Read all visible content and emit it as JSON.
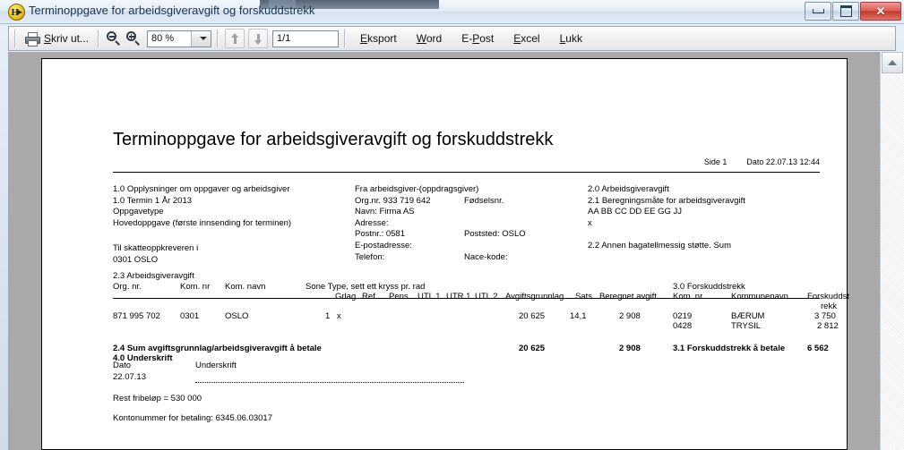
{
  "window": {
    "title": "Terminoppgave for arbeidsgiveravgift og forskuddstrekk",
    "app_icon_letter": "H",
    "minimize_label": "Minimer",
    "maximize_label": "Maksimer",
    "close_label": "Lukk vindu"
  },
  "toolbar": {
    "print_label_pre": "S",
    "print_label_post": "kriv ut...",
    "zoom_out_icon": "zoom-out-icon",
    "zoom_in_icon": "zoom-in-icon",
    "zoom_value": "80 %",
    "page_prev_icon": "page-up-icon",
    "page_next_icon": "page-down-icon",
    "page_value": "1/1",
    "buttons": [
      {
        "pre": "E",
        "mid": "ksport",
        "post": ""
      },
      {
        "pre": "W",
        "mid": "ord",
        "post": ""
      },
      {
        "pre": "E-",
        "mid": "P",
        "post": "ost"
      },
      {
        "pre": "E",
        "mid": "xcel",
        "post": ""
      },
      {
        "pre": "L",
        "mid": "ukk",
        "post": ""
      }
    ],
    "export_label": "Eksport",
    "word_label": "Word",
    "epost_label": "E-Post",
    "excel_label": "Excel",
    "lukk_label": "Lukk"
  },
  "document": {
    "title": "Terminoppgave for arbeidsgiveravgift og forskuddstrekk",
    "page_label": "Side 1",
    "date_label": "Dato  22.07.13 12:44",
    "section_1_0": "1.0 Opplysninger om oppgaver og arbeidsgiver",
    "termin_line": "1.0 Termin   1   År   2013",
    "oppgavetype": "Oppgavetype",
    "hovedoppgave": "Hovedoppgave (første innsending for terminen)",
    "til_skatteoppkreveren": "Til skatteoppkreveren i",
    "til_kommune": "0301 OSLO",
    "fra_arbeidsgiver": "Fra arbeidsgiver-(oppdragsgiver)",
    "orgnr_label": "Org.nr. 933 719 642",
    "fodselsnr_label": "Fødselsnr.",
    "navn_label": "Navn: Firma AS",
    "adresse_label": "Adresse:",
    "postnr_label": "Postnr.: 0581",
    "poststed_label": "Poststed: OSLO",
    "epostadresse_label": "E-postadresse:",
    "telefon_label": "Telefon:",
    "nacekode_label": "Nace-kode:",
    "section_2_0": "2.0 Arbeidsgiveravgift",
    "section_2_1": "2.1 Beregningsmåte for arbeidsgiveravgift",
    "beregning_codes": "AA   BB   CC   DD     EE   GG   JJ",
    "beregning_mark": "x",
    "section_2_2": "2.2 Annen bagatellmessig støtte. Sum",
    "section_2_3": "2.3 Arbeidsgiveravgift",
    "section_3_0": "3.0 Forskuddstrekk",
    "table_headers": {
      "orgnr": "Org. nr.",
      "komnr": "Kom. nr",
      "komnavn": "Kom. navn",
      "sone_type": "Sone Type, sett ett kryss pr. rad",
      "grlag": "Grlag",
      "ref": "Ref",
      "pens": "Pens",
      "utl1": "UTL 1",
      "utr1": "UTR 1",
      "utl2": "UTL 2",
      "avgiftsgrunnlag": "Avgiftsgrunnlag",
      "sats": "Sats",
      "beregnet_avgift": "Beregnet avgift",
      "f_komnr": "Kom. nr",
      "f_kommunenavn": "Kommunenavn",
      "f_forskuddstrekk_l1": "Forskuddst",
      "f_forskuddstrekk_l2": "rekk"
    },
    "table_row": {
      "orgnr": "871 995 702",
      "komnr": "0301",
      "komnavn": "OSLO",
      "sone": "1",
      "kryss": "x",
      "avgiftsgrunnlag": "20 625",
      "sats": "14,1",
      "beregnet_avgift": "2 908"
    },
    "forskudd_rows": [
      {
        "komnr": "0219",
        "kommunenavn": "BÆRUM",
        "belop": "3 750"
      },
      {
        "komnr": "0428",
        "kommunenavn": "TRYSIL",
        "belop": "2 812"
      }
    ],
    "sum_label": "2.4 Sum avgiftsgrunnlag/arbeidsgiveravgift å betale",
    "sum_grunnlag": "20 625",
    "sum_avgift": "2 908",
    "sum_forskudd_label": "3.1 Forskuddstrekk å betale",
    "sum_forskudd_value": "6 562",
    "section_4_0": "4.0 Underskrift",
    "dato_label": "Dato",
    "dato_value": "22.07.13",
    "underskrift_label": "Underskrift",
    "rest_fribelop": "Rest fribeløp = 530 000",
    "kontonummer": "Kontonummer for betaling: 6345.06.03017"
  }
}
